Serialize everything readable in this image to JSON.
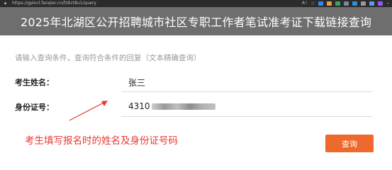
{
  "browser": {
    "url": "https://gplvcl.fanqier.cn/f/dict8u1/query",
    "reader_label": "A˦",
    "lock_icon": "lock-icon"
  },
  "page": {
    "title": "2025年北湖区公开招聘城市社区专职工作者笔试准考证下载链接查询",
    "hint": "请输入查询条件，查询符合条件的回复（文本精确查询）"
  },
  "form": {
    "name_label": "考生姓名：",
    "name_value": "张三",
    "id_label": "身份证号：",
    "id_value_prefix": "4310"
  },
  "annotation": "考生填写报名时的姓名及身份证号码",
  "query_button": "查询",
  "colors": {
    "title_bg": "#6e6e6e",
    "button_bg": "#ee6a2c",
    "annotation": "#e53935"
  }
}
